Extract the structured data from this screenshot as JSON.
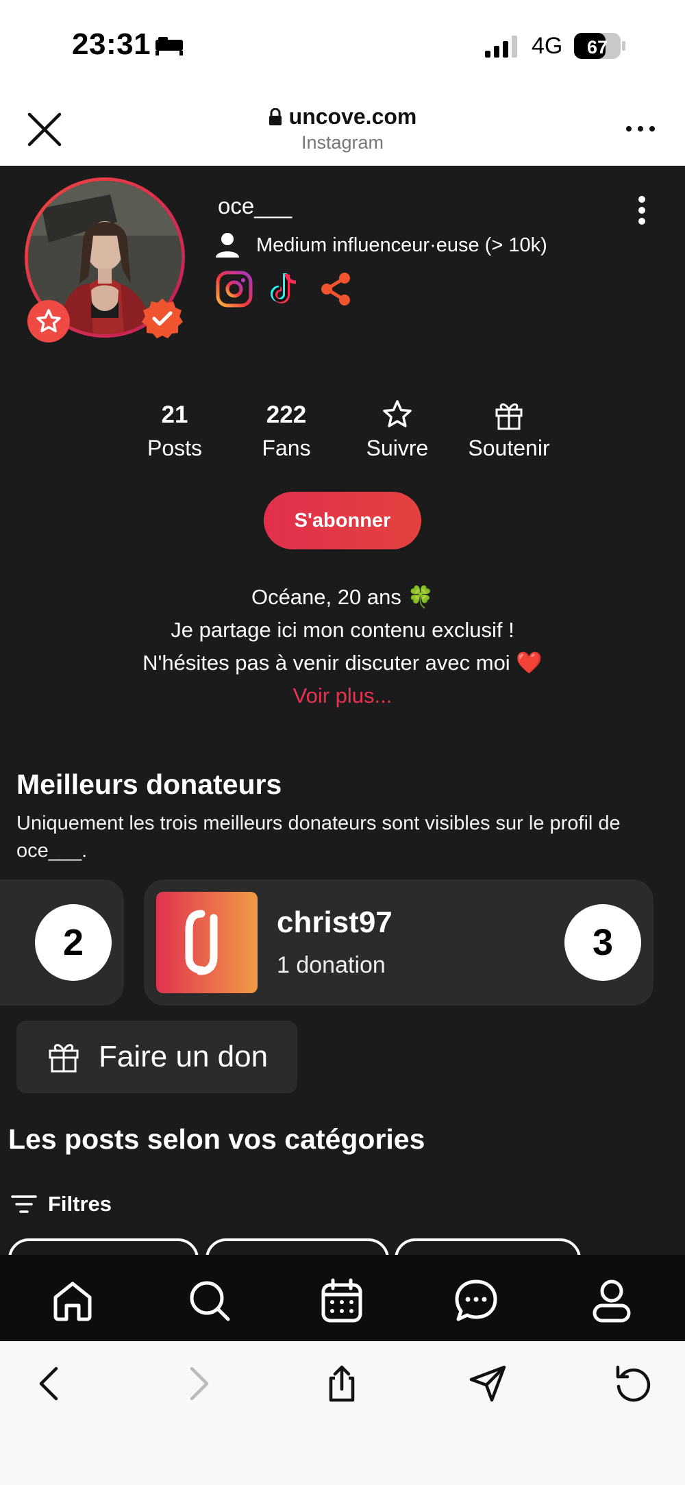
{
  "status_bar": {
    "time": "23:31",
    "network": "4G",
    "battery": "67"
  },
  "browser": {
    "url": "uncove.com",
    "subtitle": "Instagram"
  },
  "profile": {
    "username": "oce___",
    "category": "Medium influenceur·euse (> 10k)",
    "socials": [
      "instagram-icon",
      "tiktok-icon",
      "share-icon"
    ]
  },
  "stats": {
    "posts_count": "21",
    "posts_label": "Posts",
    "fans_count": "222",
    "fans_label": "Fans",
    "follow_label": "Suivre",
    "support_label": "Soutenir"
  },
  "subscribe_label": "S'abonner",
  "bio": {
    "line1": "Océane, 20 ans 🍀",
    "line2": "Je partage ici mon contenu exclusif !",
    "line3": "N'hésites pas à venir discuter avec moi ❤️",
    "more": "Voir plus..."
  },
  "donors": {
    "title": "Meilleurs donateurs",
    "description": "Uniquement les trois meilleurs donateurs sont visibles sur le profil de oce___.",
    "left_rank": "2",
    "card": {
      "name": "christ97",
      "count": "1 donation",
      "rank": "3"
    },
    "gift_label": "Faire un don"
  },
  "posts": {
    "title": "Les posts selon vos catégories",
    "filters_label": "Filtres"
  },
  "colors": {
    "accent": "#e53350",
    "background": "#1b1b1b",
    "card": "#2b2b2b"
  }
}
